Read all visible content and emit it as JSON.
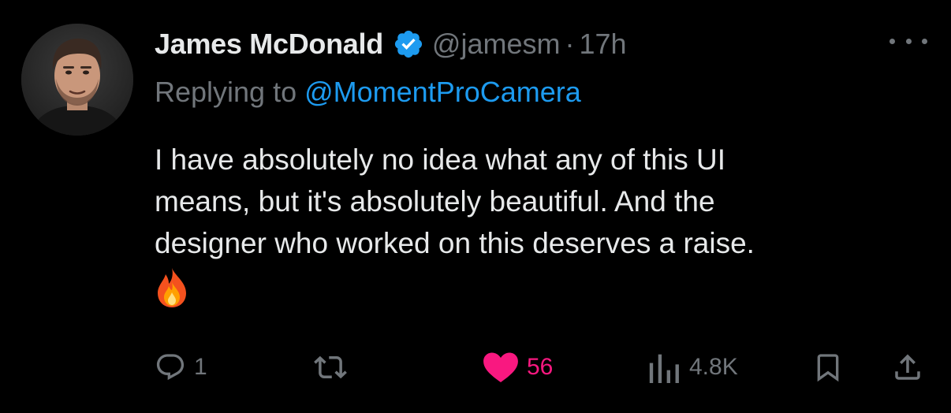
{
  "author": {
    "display_name": "James McDonald",
    "handle": "@jamesm",
    "separator": "·",
    "time": "17h",
    "verified_icon": "verified-badge-icon",
    "avatar": "avatar-photo"
  },
  "reply": {
    "prefix": "Replying to ",
    "target": "@MomentProCamera"
  },
  "tweet": {
    "lines": [
      "I have absolutely no idea what any of this UI",
      "means, but it's absolutely beautiful. And the",
      "designer who worked on this deserves a raise."
    ],
    "emoji": "fire-emoji"
  },
  "actions": {
    "reply": {
      "icon": "reply-icon",
      "count": "1"
    },
    "retweet": {
      "icon": "retweet-icon",
      "count": ""
    },
    "like": {
      "icon": "heart-icon",
      "count": "56",
      "liked": true
    },
    "views": {
      "icon": "views-icon",
      "count": "4.8K"
    },
    "bookmark": {
      "icon": "bookmark-icon"
    },
    "share": {
      "icon": "share-icon"
    }
  },
  "colors": {
    "background": "#000000",
    "text_primary": "#e7e9ea",
    "text_secondary": "#71767b",
    "link": "#1d9bf0",
    "like": "#f91880",
    "verified": "#1d9bf0"
  }
}
